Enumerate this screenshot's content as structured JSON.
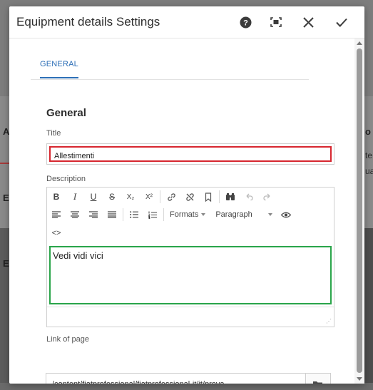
{
  "background": {
    "letters": [
      "A",
      "E",
      "E",
      "o",
      "te",
      "ua"
    ]
  },
  "dialog": {
    "title": "Equipment details Settings",
    "icons": {
      "help": "help-icon",
      "fullscreen": "fullscreen-icon",
      "close": "close-icon",
      "done": "checkmark-icon"
    }
  },
  "tabs": [
    {
      "label": "GENERAL",
      "active": true
    }
  ],
  "form": {
    "section_title": "General",
    "title_label": "Title",
    "title_value": "Allestimenti",
    "description_label": "Description",
    "description_value": "Vedi vidi vici",
    "toolbar": {
      "row1": [
        "B",
        "I",
        "U",
        "S",
        "X₂",
        "X²",
        "link-icon",
        "unlink-icon",
        "anchor-icon",
        "find-replace-icon",
        "undo-icon",
        "redo-icon"
      ],
      "formats_label": "Formats",
      "paragraph_label": "Paragraph",
      "source_label": "<>"
    },
    "link_label": "Link of page",
    "link_value": "/content/fiatprofessional/fiatprofessional-it/it/prova"
  },
  "colors": {
    "accent": "#2d6fb7",
    "title_highlight": "#d7262f",
    "description_highlight": "#2aa54a"
  }
}
